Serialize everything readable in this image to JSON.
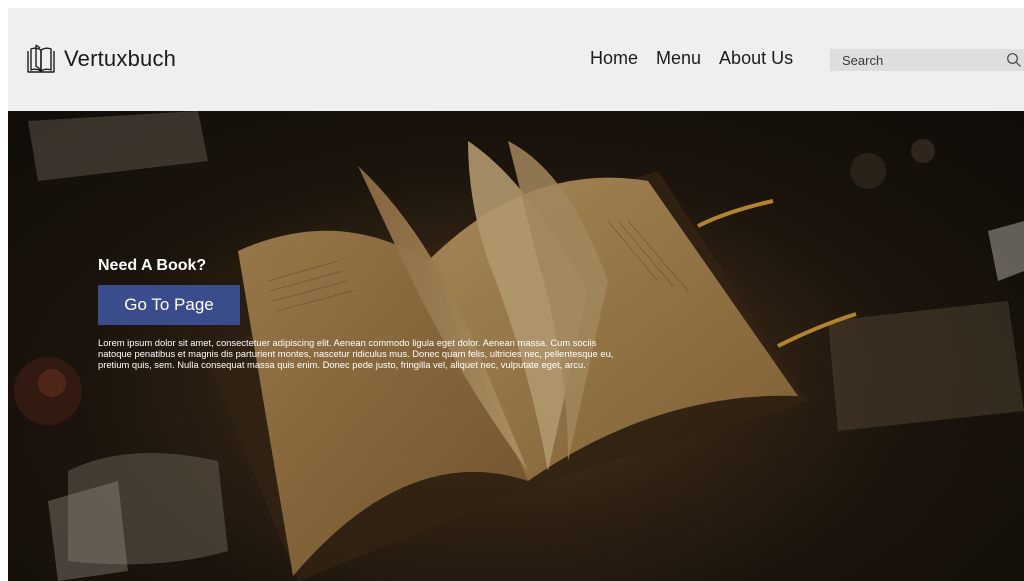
{
  "header": {
    "brand_name": "Vertuxbuch",
    "nav": [
      {
        "label": "Home"
      },
      {
        "label": "Menu"
      },
      {
        "label": "About Us"
      }
    ],
    "search": {
      "placeholder": "Search",
      "icon": "search-icon"
    }
  },
  "hero": {
    "heading": "Need A Book?",
    "cta_label": "Go To Page",
    "body_text": "Lorem ipsum dolor sit amet, consectetuer adipiscing elit. Aenean commodo ligula eget dolor. Aenean massa. Cum sociis natoque penatibus et magnis dis parturient montes, nascetur ridiculus mus. Donec quam felis, ultricies nec, pellentesque eu, pretium quis, sem. Nulla consequat massa quis enim. Donec pede justo, fringilla vel, aliquet nec, vulputate eget, arcu."
  },
  "colors": {
    "navbar_bg": "#efefef",
    "cta_bg": "#3b4c8c",
    "hero_text": "#ffffff"
  }
}
